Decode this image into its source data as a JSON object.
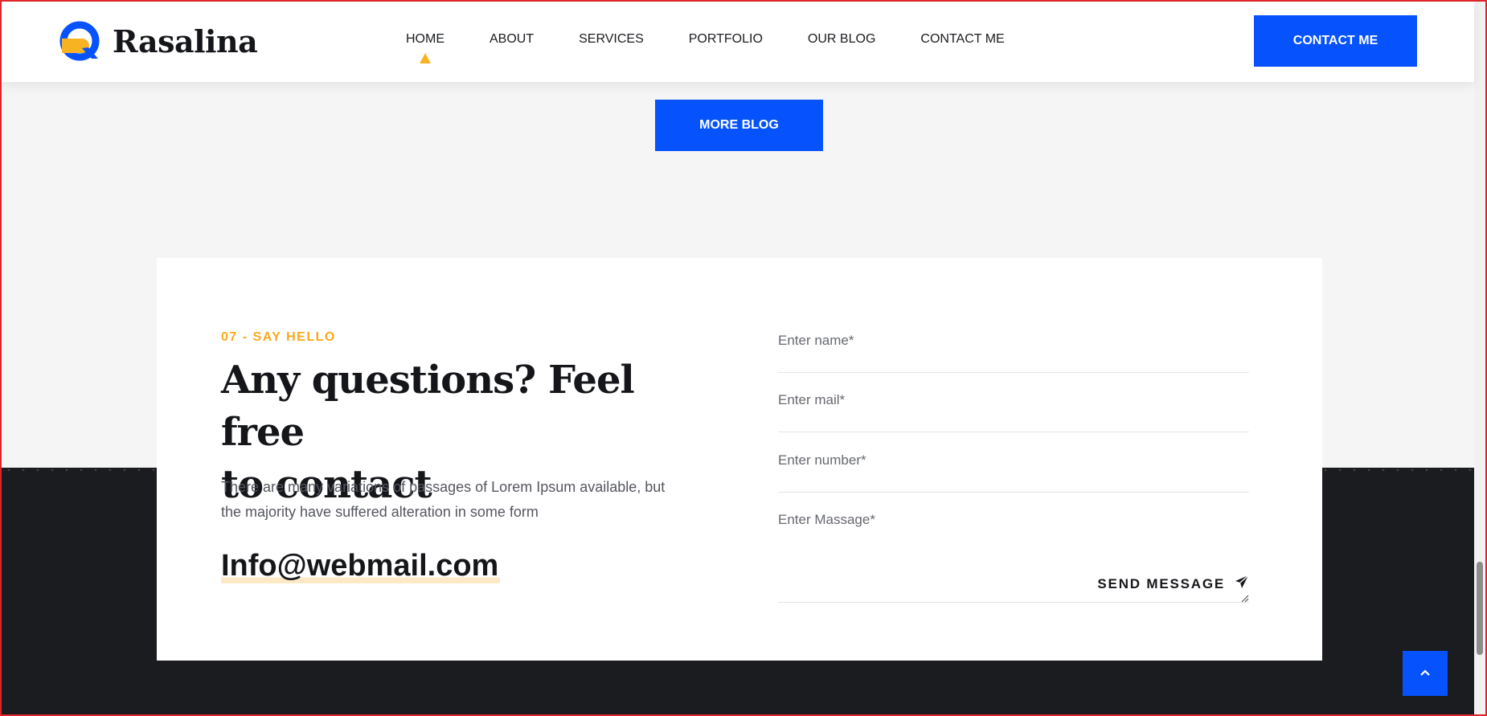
{
  "header": {
    "brand": "Rasalina",
    "nav": [
      {
        "label": "HOME"
      },
      {
        "label": "ABOUT"
      },
      {
        "label": "SERVICES"
      },
      {
        "label": "PORTFOLIO"
      },
      {
        "label": "OUR BLOG"
      },
      {
        "label": "CONTACT ME"
      }
    ],
    "active_nav": "HOME",
    "cta_label": "CONTACT ME"
  },
  "blog": {
    "more_label": "MORE BLOG"
  },
  "contact": {
    "eyebrow": "07 - SAY HELLO",
    "title_line1": "Any questions? Feel free",
    "title_line2": "to contact",
    "description": "There are many variations of passages of Lorem Ipsum available, but the majority have suffered alteration in some form",
    "email": "Info@webmail.com"
  },
  "form": {
    "name_placeholder": "Enter name*",
    "mail_placeholder": "Enter mail*",
    "number_placeholder": "Enter number*",
    "message_placeholder": "Enter Massage*",
    "send_label": "SEND MESSAGE"
  },
  "icons": {
    "send": "paper-plane-icon",
    "back_to_top": "chevron-up-icon",
    "logo": "r-logo-mark"
  },
  "colors": {
    "accent_blue": "#0652fd",
    "accent_orange": "#f8b323",
    "dark": "#1b1c20",
    "surface": "#f5f5f5"
  }
}
